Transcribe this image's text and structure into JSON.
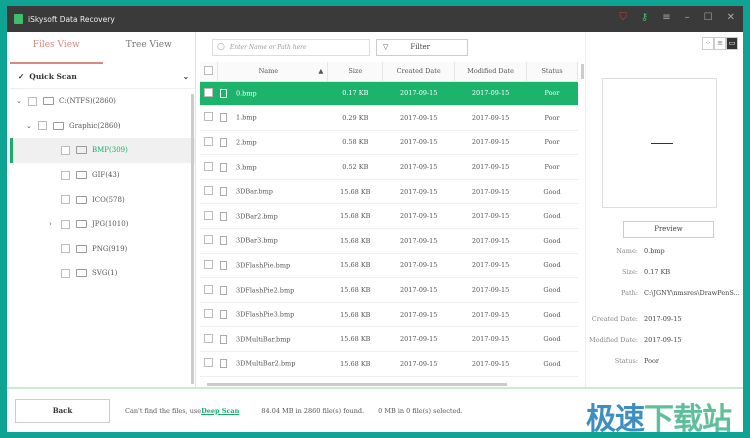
{
  "title": "iSkysoft Data Recovery",
  "title_icons": [
    "cart-icon",
    "key-icon",
    "menu-icon",
    "minimize-icon",
    "maximize-icon",
    "close-icon"
  ],
  "left": {
    "tabs": [
      "Files View",
      "Tree View"
    ],
    "quick_scan": "Quick Scan",
    "tree": [
      {
        "label": "C:(NTFS)(2860)",
        "level": 0,
        "expanded": true
      },
      {
        "label": "Graphic(2860)",
        "level": 1,
        "expanded": true
      },
      {
        "label": "BMP(309)",
        "level": 2,
        "selected": true
      },
      {
        "label": "GIF(43)",
        "level": 2
      },
      {
        "label": "ICO(578)",
        "level": 2
      },
      {
        "label": "JPG(1010)",
        "level": 2,
        "collapsed": true
      },
      {
        "label": "PNG(919)",
        "level": 2
      },
      {
        "label": "SVG(1)",
        "level": 2
      }
    ]
  },
  "search": {
    "placeholder": "Enter Name or Path here"
  },
  "filter_label": "Filter",
  "columns": [
    "Name",
    "Size",
    "Created Date",
    "Modified Date",
    "Status"
  ],
  "rows": [
    [
      "0.bmp",
      "0.17 KB",
      "2017-09-15",
      "2017-09-15",
      "Poor"
    ],
    [
      "1.bmp",
      "0.29 KB",
      "2017-09-15",
      "2017-09-15",
      "Poor"
    ],
    [
      "2.bmp",
      "0.58 KB",
      "2017-09-15",
      "2017-09-15",
      "Poor"
    ],
    [
      "3.bmp",
      "0.52 KB",
      "2017-09-15",
      "2017-09-15",
      "Poor"
    ],
    [
      "3DBar.bmp",
      "15.68 KB",
      "2017-09-15",
      "2017-09-15",
      "Good"
    ],
    [
      "3DBar2.bmp",
      "15.68 KB",
      "2017-09-15",
      "2017-09-15",
      "Good"
    ],
    [
      "3DBar3.bmp",
      "15.68 KB",
      "2017-09-15",
      "2017-09-15",
      "Good"
    ],
    [
      "3DFlashPie.bmp",
      "15.68 KB",
      "2017-09-15",
      "2017-09-15",
      "Good"
    ],
    [
      "3DFlashPie2.bmp",
      "15.68 KB",
      "2017-09-15",
      "2017-09-15",
      "Good"
    ],
    [
      "3DFlashPie3.bmp",
      "15.68 KB",
      "2017-09-15",
      "2017-09-15",
      "Good"
    ],
    [
      "3DMultiBar.bmp",
      "15.68 KB",
      "2017-09-15",
      "2017-09-15",
      "Good"
    ],
    [
      "3DMultiBar2.bmp",
      "15.68 KB",
      "2017-09-15",
      "2017-09-15",
      "Good"
    ]
  ],
  "details": {
    "preview_label": "Preview",
    "fields": [
      [
        "Name:",
        "0.bmp"
      ],
      [
        "Size:",
        "0.17 KB"
      ],
      [
        "Path:",
        "C:\\JGNY\\nmsres\\DrawPenS..."
      ],
      [
        "Created Date:",
        "2017-09-15"
      ],
      [
        "Modified Date:",
        "2017-09-15"
      ],
      [
        "Status:",
        "Poor"
      ]
    ]
  },
  "footer": {
    "back": "Back",
    "hint": "Can't find the files, use ",
    "deep_scan": "Deep Scan",
    "found": "84.04 MB in 2860 file(s) found.",
    "selected": "0 MB in 0 file(s) selected."
  },
  "watermark": "极速下载站",
  "accent": "#1cb46a"
}
